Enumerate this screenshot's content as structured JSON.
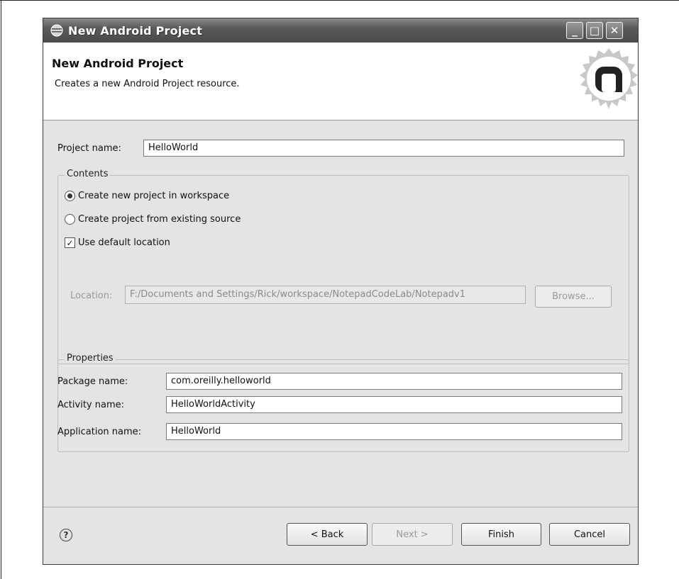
{
  "window": {
    "title": "New Android Project",
    "controls": {
      "minimize": "_",
      "maximize": "□",
      "close": "✕"
    }
  },
  "header": {
    "title": "New Android Project",
    "description": "Creates a new Android Project resource.",
    "logo_icon": "android-adt-logo-icon"
  },
  "project": {
    "label": "Project name:",
    "value": "HelloWorld"
  },
  "contents": {
    "legend": "Contents",
    "options": [
      {
        "label": "Create new project in workspace",
        "selected": true
      },
      {
        "label": "Create project from existing source",
        "selected": false
      }
    ],
    "use_default": {
      "label": "Use default location",
      "checked": true
    },
    "location": {
      "label": "Location:",
      "value": "F:/Documents and Settings/Rick/workspace/NotepadCodeLab/Notepadv1",
      "browse": "Browse..."
    }
  },
  "properties": {
    "legend": "Properties",
    "fields": [
      {
        "label": "Package name:",
        "value": "com.oreilly.helloworld"
      },
      {
        "label": "Activity name:",
        "value": "HelloWorldActivity"
      },
      {
        "label": "Application name:",
        "value": "HelloWorld"
      }
    ]
  },
  "footer": {
    "help": "?",
    "back": "< Back",
    "next": "Next >",
    "finish": "Finish",
    "cancel": "Cancel"
  }
}
